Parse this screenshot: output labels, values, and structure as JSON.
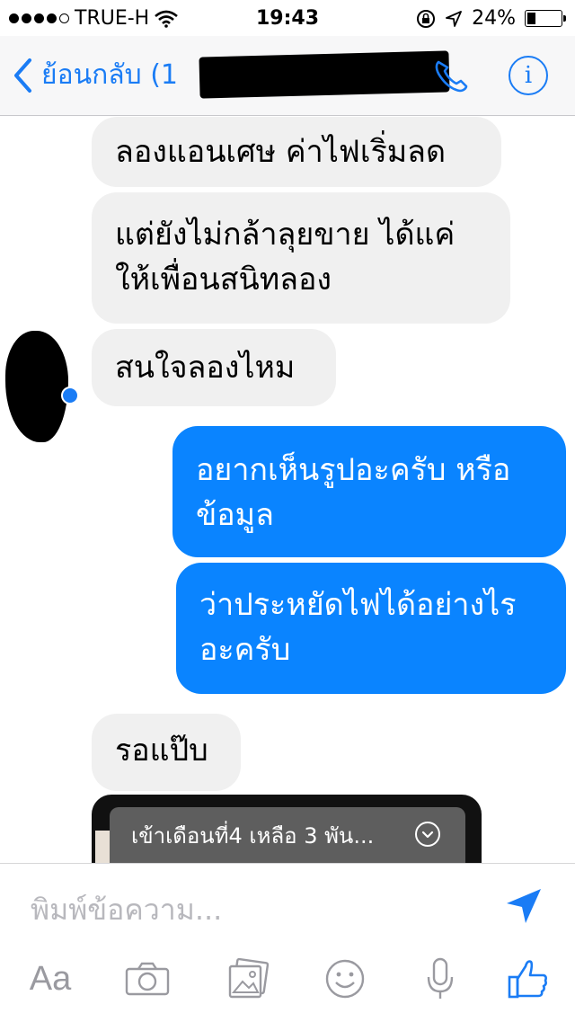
{
  "status_bar": {
    "carrier": "TRUE-H",
    "time": "19:43",
    "battery": "24%"
  },
  "nav": {
    "back_label": "ย้อนกลับ (1"
  },
  "messages": [
    {
      "direction": "in",
      "lines": [
        "ลองแอนเศษ ค่าไฟเริ่มลด"
      ]
    },
    {
      "direction": "in",
      "lines": [
        "แต่ยังไม่กล้าลุยขาย ได้แค่",
        "ให้เพื่อนสนิทลอง"
      ]
    },
    {
      "direction": "in",
      "lines": [
        "สนใจลองไหม"
      ]
    },
    {
      "direction": "out",
      "lines": [
        "อยากเห็นรูปอะครับ หรือ",
        "ข้อมูล"
      ]
    },
    {
      "direction": "out",
      "lines": [
        "ว่าประหยัดไฟได้อย่างไร",
        "อะครับ"
      ]
    },
    {
      "direction": "in",
      "lines": [
        "รอแป๊บ"
      ]
    }
  ],
  "media_caption": "เข้าเดือนที่4 เหลือ 3 พัน...",
  "composer": {
    "placeholder": "พิมพ์ข้อความ...",
    "aa_label": "Aa"
  },
  "colors": {
    "accent": "#1a7cf5",
    "outgoing_bubble": "#0a84ff",
    "incoming_bubble": "#f0f0f0"
  }
}
